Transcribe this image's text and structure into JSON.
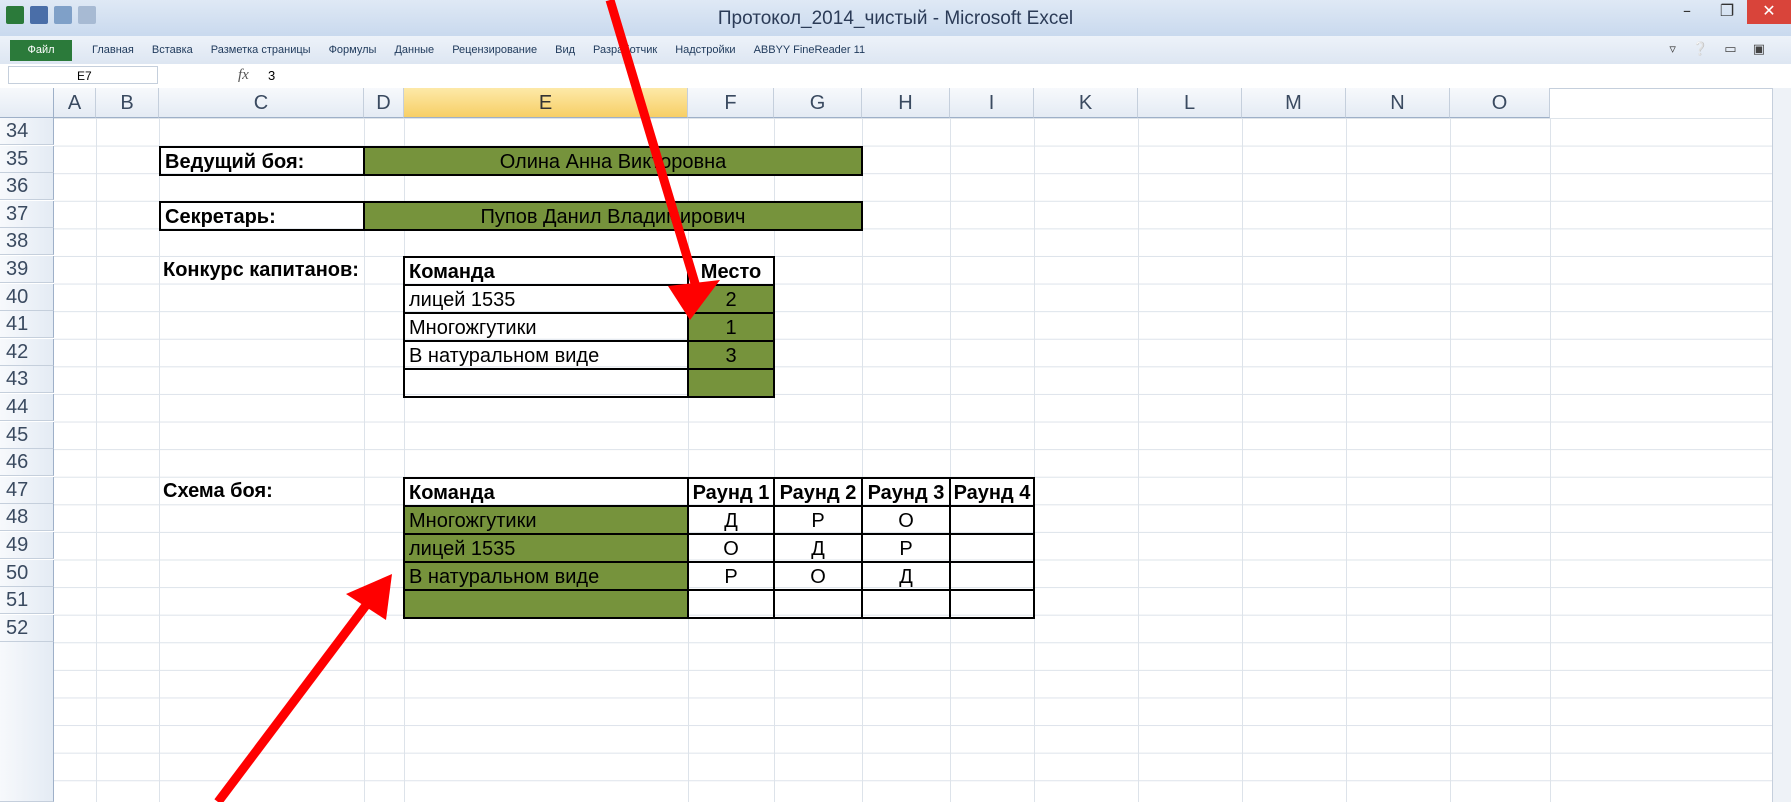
{
  "window": {
    "title": "Протокол_2014_чистый - Microsoft Excel"
  },
  "ribbon": {
    "file": "Файл",
    "tabs": [
      "Главная",
      "Вставка",
      "Разметка страницы",
      "Формулы",
      "Данные",
      "Рецензирование",
      "Вид",
      "Разработчик",
      "Надстройки",
      "ABBYY FineReader 11"
    ]
  },
  "formula_bar": {
    "cell_ref": "E7",
    "fx": "fx",
    "value": "3"
  },
  "columns": [
    "A",
    "B",
    "C",
    "D",
    "E",
    "F",
    "G",
    "H",
    "I",
    "K",
    "L",
    "M",
    "N",
    "O"
  ],
  "rows": [
    "34",
    "35",
    "36",
    "37",
    "38",
    "39",
    "40",
    "41",
    "42",
    "43",
    "44",
    "45",
    "46",
    "47",
    "48",
    "49",
    "50",
    "51",
    "52"
  ],
  "leader": {
    "label": "Ведущий боя:",
    "value": "Олина Анна Викторовна"
  },
  "secretary": {
    "label": "Секретарь:",
    "value": "Пупов Данил Владимирович"
  },
  "captains": {
    "label": "Конкурс капитанов:",
    "header_team": "Команда",
    "header_place": "Место",
    "rows": [
      {
        "team": "лицей 1535",
        "place": "2"
      },
      {
        "team": "Многожгутики",
        "place": "1"
      },
      {
        "team": "В натуральном виде",
        "place": "3"
      },
      {
        "team": "",
        "place": ""
      }
    ]
  },
  "scheme": {
    "label": "Схема боя:",
    "headers": [
      "Команда",
      "Раунд 1",
      "Раунд 2",
      "Раунд 3",
      "Раунд 4"
    ],
    "rows": [
      [
        "Многожгутики",
        "Д",
        "Р",
        "О",
        ""
      ],
      [
        "лицей 1535",
        "О",
        "Д",
        "Р",
        ""
      ],
      [
        "В натуральном виде",
        "Р",
        "О",
        "Д",
        ""
      ],
      [
        "",
        "",
        "",
        "",
        ""
      ]
    ]
  },
  "colors": {
    "accent_green": "#76933c",
    "arrow_red": "#ff0000"
  }
}
